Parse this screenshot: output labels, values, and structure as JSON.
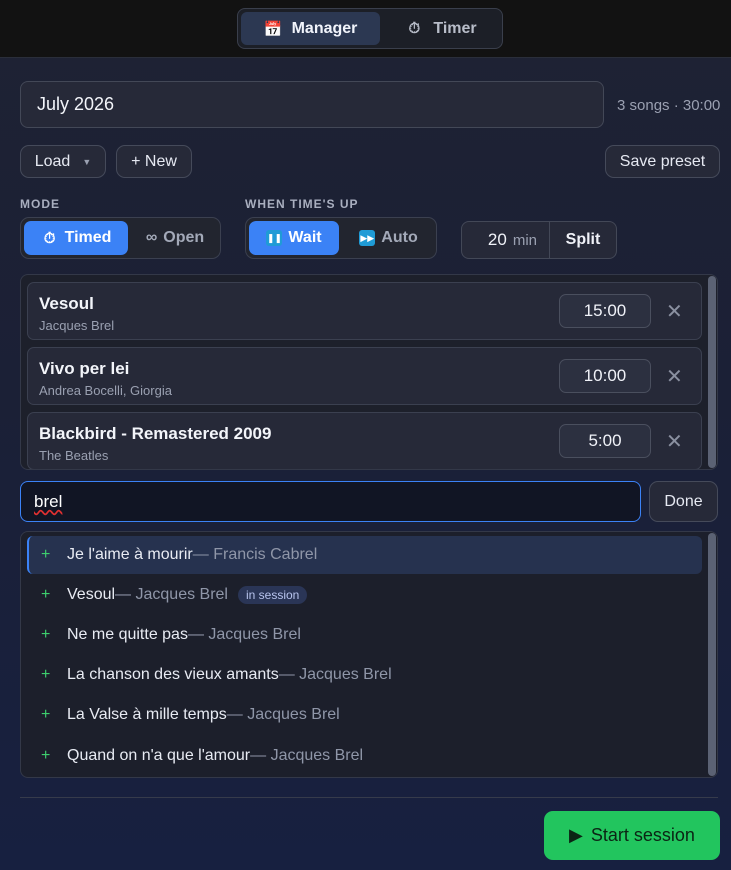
{
  "header": {
    "tabs": [
      {
        "label": "Manager",
        "icon": "calendar-icon",
        "active": true
      },
      {
        "label": "Timer",
        "icon": "stopwatch-icon",
        "active": false
      }
    ]
  },
  "session": {
    "title": "July 2026",
    "summary": "3 songs · 30:00"
  },
  "toolbar": {
    "load_label": "Load",
    "new_label": "+ New",
    "save_preset_label": "Save preset"
  },
  "mode": {
    "label": "MODE",
    "options": [
      "Timed",
      "Open"
    ],
    "selected": "Timed"
  },
  "times_up": {
    "label": "WHEN TIME'S UP",
    "options": [
      "Wait",
      "Auto"
    ],
    "selected": "Wait"
  },
  "split": {
    "minutes": "20",
    "unit": "min",
    "button_label": "Split"
  },
  "songs": [
    {
      "title": "Vesoul",
      "artist": "Jacques Brel",
      "duration": "15:00"
    },
    {
      "title": "Vivo per lei",
      "artist": "Andrea Bocelli, Giorgia",
      "duration": "10:00"
    },
    {
      "title": "Blackbird - Remastered 2009",
      "artist": "The Beatles",
      "duration": "5:00"
    }
  ],
  "search": {
    "query": "brel",
    "done_label": "Done"
  },
  "results": [
    {
      "title": "Je l'aime à mourir",
      "artist": " — Francis Cabrel",
      "highlighted": true
    },
    {
      "title": "Vesoul",
      "artist": " — Jacques Brel",
      "badge": "in session"
    },
    {
      "title": "Ne me quitte pas",
      "artist": " — Jacques Brel"
    },
    {
      "title": "La chanson des vieux amants",
      "artist": " — Jacques Brel"
    },
    {
      "title": "La Valse à mille temps",
      "artist": " — Jacques Brel"
    },
    {
      "title": "Quand on n'a que l'amour",
      "artist": " — Jacques Brel"
    }
  ],
  "footer": {
    "start_label": "Start session"
  },
  "colors": {
    "accent": "#3b82f6",
    "success": "#22c55e"
  }
}
